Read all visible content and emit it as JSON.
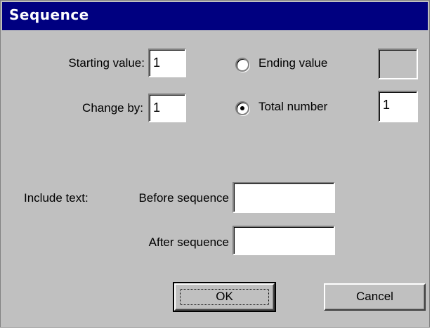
{
  "window": {
    "title": "Sequence"
  },
  "start": {
    "label": "Starting value:",
    "value": "1"
  },
  "change": {
    "label": "Change by:",
    "value": "1"
  },
  "ending": {
    "label": "Ending value",
    "value": ""
  },
  "total": {
    "label": "Total number",
    "value": "1"
  },
  "include": {
    "label": "Include text:",
    "before_label": "Before sequence",
    "before_value": "",
    "after_label": "After sequence",
    "after_value": ""
  },
  "buttons": {
    "ok": "OK",
    "cancel": "Cancel"
  },
  "colors": {
    "titlebar": "#000080",
    "face": "#c0c0c0"
  }
}
